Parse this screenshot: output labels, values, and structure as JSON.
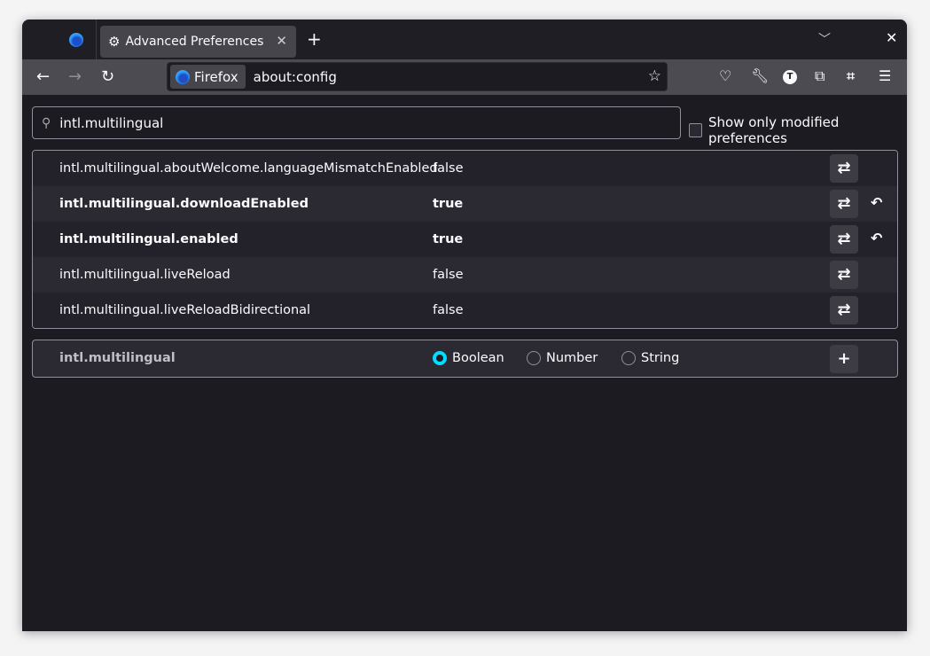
{
  "browser": {
    "tab_title": "Advanced Preferences",
    "identity_label": "Firefox",
    "url": "about:config"
  },
  "search": {
    "value": "intl.multilingual",
    "show_modified_label": "Show only modified preferences"
  },
  "prefs": [
    {
      "name": "intl.multilingual.aboutWelcome.languageMismatchEnabled",
      "value": "false",
      "modified": false
    },
    {
      "name": "intl.multilingual.downloadEnabled",
      "value": "true",
      "modified": true
    },
    {
      "name": "intl.multilingual.enabled",
      "value": "true",
      "modified": true
    },
    {
      "name": "intl.multilingual.liveReload",
      "value": "false",
      "modified": false
    },
    {
      "name": "intl.multilingual.liveReloadBidirectional",
      "value": "false",
      "modified": false
    }
  ],
  "new_pref": {
    "name": "intl.multilingual",
    "types": [
      "Boolean",
      "Number",
      "String"
    ],
    "selected": "Boolean"
  },
  "colors": {
    "accent": "#00ddff",
    "background": "#1c1b22"
  }
}
